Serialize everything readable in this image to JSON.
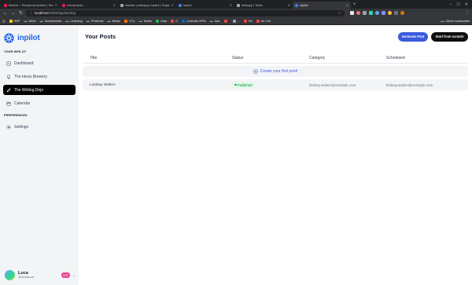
{
  "browser": {
    "tabs": [
      {
        "title": "NextJs + Storybook Addon | Sto",
        "favicon_color": "#e11d48",
        "active": false
      },
      {
        "title": "Visual tests",
        "favicon_color": "#e11d48",
        "active": false
      },
      {
        "title": "slmake | webapp | inpilot | Supa",
        "favicon_color": "#9ca3af",
        "active": false
      },
      {
        "title": "inpilot",
        "favicon_color": "#3b82f6",
        "active": false
      },
      {
        "title": "webapp | Tedio",
        "favicon_color": "#9ca3af",
        "active": false
      },
      {
        "title": "inpilot",
        "favicon_color": "#3b82f6",
        "active": true
      }
    ],
    "new_tab_glyph": "+",
    "url_host": "localhost",
    "url_path": ":3000/app/writing",
    "bookmarks": [
      {
        "label": "WIP",
        "color": "#facc15"
      },
      {
        "label": "Work",
        "color": "#9ca3af"
      },
      {
        "label": "Investments",
        "color": "#9ca3af"
      },
      {
        "label": "Learning",
        "color": "#9ca3af"
      },
      {
        "label": "Products",
        "color": "#9ca3af"
      },
      {
        "label": "Music",
        "color": "#9ca3af"
      },
      {
        "label": "YCL",
        "color": "#f97316"
      },
      {
        "label": "Notes",
        "color": "#9ca3af"
      },
      {
        "label": "Idea",
        "color": "#22c55e"
      },
      {
        "label": "G",
        "color": "#ef4444"
      },
      {
        "label": "LinkedIn APIs",
        "color": "#0a66c2"
      },
      {
        "label": "Iran",
        "color": "#9ca3af"
      },
      {
        "label": "",
        "color": "#ef4444"
      },
      {
        "label": "...",
        "color": "#9ca3af"
      },
      {
        "label": "Ro",
        "color": "#ef4444"
      },
      {
        "label": "de 144",
        "color": "#ef4444"
      }
    ],
    "other_bookmarks": "Other bookmarks"
  },
  "sidebar": {
    "brand": "inpilot",
    "section_main": "YOUR INPILOT",
    "items": [
      {
        "label": "Dashboard",
        "icon": "dashboard-icon",
        "active": false
      },
      {
        "label": "The Ideas Brewery",
        "icon": "lightbulb-icon",
        "active": false
      },
      {
        "label": "The Writing Dojo",
        "icon": "pen-icon",
        "active": true
      },
      {
        "label": "Calendar",
        "icon": "calendar-icon",
        "active": false
      }
    ],
    "section_prefs": "PREFERENCES",
    "prefs_items": [
      {
        "label": "Settings",
        "icon": "gear-icon"
      }
    ],
    "user": {
      "name": "Luca",
      "handle": "@lrestaccia",
      "badge": "1 ©",
      "caret": "⌄"
    }
  },
  "main": {
    "title": "Your Posts",
    "generate_label": "Generate Post",
    "scratch_label": "Start from scratch",
    "columns": {
      "title": "Title",
      "status": "Status",
      "category": "Category",
      "scheduled": "Scheduled"
    },
    "create_label": "Create your first post!",
    "rows": [
      {
        "title": "Lindsay Walton",
        "status": "Published",
        "category": "lindsay.walton@example.com",
        "scheduled": "lindsay.walton@example.com"
      }
    ]
  },
  "colors": {
    "accent": "#3b5bdb",
    "brand": "#2563eb",
    "published_bg": "#dcfce7",
    "published_text": "#15803d"
  }
}
